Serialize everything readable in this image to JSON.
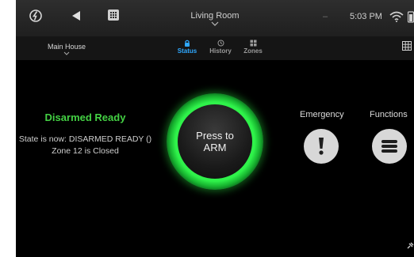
{
  "topbar": {
    "room": "Living Room",
    "separator": "–",
    "time": "5:03 PM",
    "icons": [
      "power-icon",
      "back-icon",
      "keypad-icon",
      "wifi-icon",
      "battery-icon"
    ]
  },
  "tabbar": {
    "location": "Main House",
    "tabs": [
      {
        "label": "Status",
        "icon": "lock-icon",
        "active": true
      },
      {
        "label": "History",
        "icon": "history-icon",
        "active": false
      },
      {
        "label": "Zones",
        "icon": "zones-icon",
        "active": false
      }
    ],
    "grid_icon": "grid-icon"
  },
  "status": {
    "title": "Disarmed Ready",
    "line1": "State is now: DISARMED READY ()",
    "line2": "Zone 12 is Closed"
  },
  "arm_button": {
    "line1": "Press to",
    "line2": "ARM"
  },
  "actions": {
    "emergency": {
      "label": "Emergency",
      "icon": "exclamation-icon"
    },
    "functions": {
      "label": "Functions",
      "icon": "menu-icon"
    }
  },
  "colors": {
    "status_green": "#44d144",
    "ring_green": "#2ff24a",
    "active_tab": "#2fa8ff",
    "background": "#000000"
  }
}
